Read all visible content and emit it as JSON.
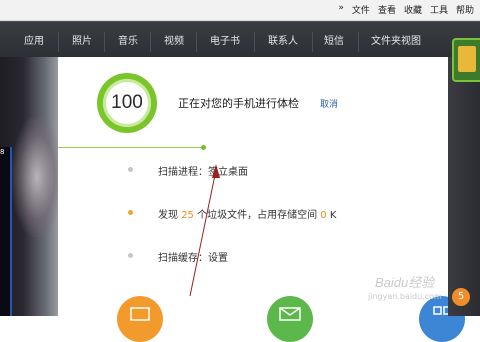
{
  "top_menu": {
    "more": "»",
    "items": [
      "文件",
      "查看",
      "收藏",
      "工具",
      "帮助"
    ]
  },
  "tabs": [
    "应用",
    "照片",
    "音乐",
    "视频",
    "电子书",
    "联系人",
    "短信",
    "文件夹视图"
  ],
  "left_panel": {
    "phone_label": "8"
  },
  "checkup": {
    "score": "100",
    "title": "正在对您的手机进行体检",
    "cancel": "取消"
  },
  "scan_items": [
    {
      "label": "扫描进程：签立桌面",
      "status": "gray"
    },
    {
      "prefix": "发现",
      "count": "25",
      "mid": "个垃圾文件，占用存储空间",
      "size": "0",
      "unit": "K",
      "status": "orange"
    },
    {
      "label": "扫描缓存：设置",
      "status": "gray"
    }
  ],
  "colors": {
    "score_ring": "#7ac52a",
    "accent_orange": "#f08c1e",
    "link_blue": "#2a5fb0",
    "tab_bar": "#2c2f33"
  },
  "watermark": {
    "text": "Baidu经验",
    "sub": "jingyan.baidu.com"
  },
  "badge": "5"
}
